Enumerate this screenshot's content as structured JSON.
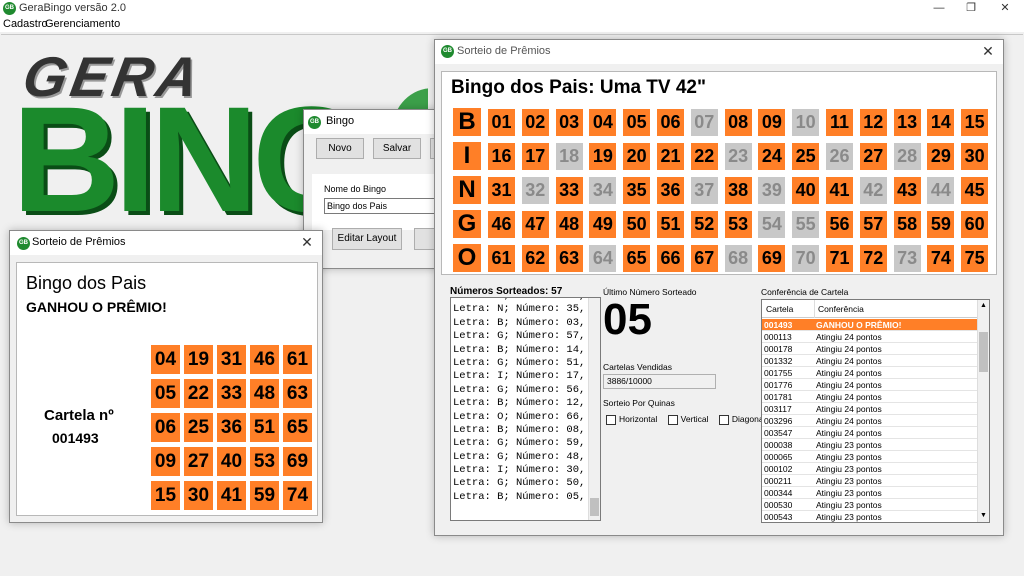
{
  "app": {
    "icon_text": "GB",
    "title": "GeraBingo  versão 2.0",
    "menu": [
      "Cadastro",
      "Gerenciamento"
    ],
    "logo_gera": "GERA",
    "logo_bingo": "BING"
  },
  "bingo_window": {
    "title": "Bingo",
    "buttons": [
      "Novo",
      "Salvar"
    ],
    "name_label": "Nome do Bingo",
    "name_value": "Bingo dos Pais",
    "edit_layout_label": "Editar Layout"
  },
  "small_prize": {
    "title": "Sorteio de Prêmios",
    "bingo_name": "Bingo dos Pais",
    "won_text": "GANHOU O PRÊMIO!",
    "card_label": "Cartela nº",
    "card_number": "001493",
    "card_grid": [
      [
        "04",
        "19",
        "31",
        "46",
        "61"
      ],
      [
        "05",
        "22",
        "33",
        "48",
        "63"
      ],
      [
        "06",
        "25",
        "36",
        "51",
        "65"
      ],
      [
        "09",
        "27",
        "40",
        "53",
        "69"
      ],
      [
        "15",
        "30",
        "41",
        "59",
        "74"
      ]
    ]
  },
  "main_prize": {
    "title": "Sorteio de Prêmios",
    "heading": "Bingo dos Pais: Uma TV 42\"",
    "letters": [
      "B",
      "I",
      "N",
      "G",
      "O"
    ],
    "board": [
      [
        [
          "01",
          1
        ],
        [
          "02",
          1
        ],
        [
          "03",
          1
        ],
        [
          "04",
          1
        ],
        [
          "05",
          1
        ],
        [
          "06",
          1
        ],
        [
          "07",
          0
        ],
        [
          "08",
          1
        ],
        [
          "09",
          1
        ],
        [
          "10",
          0
        ],
        [
          "11",
          1
        ],
        [
          "12",
          1
        ],
        [
          "13",
          1
        ],
        [
          "14",
          1
        ],
        [
          "15",
          1
        ]
      ],
      [
        [
          "16",
          1
        ],
        [
          "17",
          1
        ],
        [
          "18",
          0
        ],
        [
          "19",
          1
        ],
        [
          "20",
          1
        ],
        [
          "21",
          1
        ],
        [
          "22",
          1
        ],
        [
          "23",
          0
        ],
        [
          "24",
          1
        ],
        [
          "25",
          1
        ],
        [
          "26",
          0
        ],
        [
          "27",
          1
        ],
        [
          "28",
          0
        ],
        [
          "29",
          1
        ],
        [
          "30",
          1
        ]
      ],
      [
        [
          "31",
          1
        ],
        [
          "32",
          0
        ],
        [
          "33",
          1
        ],
        [
          "34",
          0
        ],
        [
          "35",
          1
        ],
        [
          "36",
          1
        ],
        [
          "37",
          0
        ],
        [
          "38",
          1
        ],
        [
          "39",
          0
        ],
        [
          "40",
          1
        ],
        [
          "41",
          1
        ],
        [
          "42",
          0
        ],
        [
          "43",
          1
        ],
        [
          "44",
          0
        ],
        [
          "45",
          1
        ]
      ],
      [
        [
          "46",
          1
        ],
        [
          "47",
          1
        ],
        [
          "48",
          1
        ],
        [
          "49",
          1
        ],
        [
          "50",
          1
        ],
        [
          "51",
          1
        ],
        [
          "52",
          1
        ],
        [
          "53",
          1
        ],
        [
          "54",
          0
        ],
        [
          "55",
          0
        ],
        [
          "56",
          1
        ],
        [
          "57",
          1
        ],
        [
          "58",
          1
        ],
        [
          "59",
          1
        ],
        [
          "60",
          1
        ]
      ],
      [
        [
          "61",
          1
        ],
        [
          "62",
          1
        ],
        [
          "63",
          1
        ],
        [
          "64",
          0
        ],
        [
          "65",
          1
        ],
        [
          "66",
          1
        ],
        [
          "67",
          1
        ],
        [
          "68",
          0
        ],
        [
          "69",
          1
        ],
        [
          "70",
          0
        ],
        [
          "71",
          1
        ],
        [
          "72",
          1
        ],
        [
          "73",
          0
        ],
        [
          "74",
          1
        ],
        [
          "75",
          1
        ]
      ]
    ],
    "drawn_label": "Números Sorteados: 57",
    "drawn_list": [
      "Letra: G; Número: 57,",
      "Letra: N; Número: 35,",
      "Letra: B; Número: 03,",
      "Letra: G; Número: 57,",
      "Letra: B; Número: 14,",
      "Letra: G; Número: 51,",
      "Letra: I; Número: 17,",
      "Letra: G; Número: 56,",
      "Letra: B; Número: 12,",
      "Letra: O; Número: 66,",
      "Letra: B; Número: 08,",
      "Letra: G; Número: 59,",
      "Letra: G; Número: 48,",
      "Letra: I; Número: 30,",
      "Letra: G; Número: 50,",
      "Letra: B; Número: 05,"
    ],
    "last_label": "Último Número Sorteado",
    "last_number": "05",
    "sold_label": "Cartelas Vendidas",
    "sold_value": "3886/10000",
    "quinas_label": "Sorteio Por Quinas",
    "quinas_options": [
      "Horizontal",
      "Vertical",
      "Diagonal"
    ],
    "check_label": "Conferência de Cartela",
    "check_headers": [
      "Cartela",
      "Conferência"
    ],
    "check_rows": [
      [
        "001493",
        "GANHOU O PRÊMIO!"
      ],
      [
        "000113",
        "Atingiu 24 pontos"
      ],
      [
        "000178",
        "Atingiu 24 pontos"
      ],
      [
        "001332",
        "Atingiu 24 pontos"
      ],
      [
        "001755",
        "Atingiu 24 pontos"
      ],
      [
        "001776",
        "Atingiu 24 pontos"
      ],
      [
        "001781",
        "Atingiu 24 pontos"
      ],
      [
        "003117",
        "Atingiu 24 pontos"
      ],
      [
        "003296",
        "Atingiu 24 pontos"
      ],
      [
        "003547",
        "Atingiu 24 pontos"
      ],
      [
        "000038",
        "Atingiu 23 pontos"
      ],
      [
        "000065",
        "Atingiu 23 pontos"
      ],
      [
        "000102",
        "Atingiu 23 pontos"
      ],
      [
        "000211",
        "Atingiu 23 pontos"
      ],
      [
        "000344",
        "Atingiu 23 pontos"
      ],
      [
        "000530",
        "Atingiu 23 pontos"
      ],
      [
        "000543",
        "Atingiu 23 pontos"
      ]
    ]
  },
  "colors": {
    "orange": "#ff7f27",
    "gray_cell": "#c8c8c8",
    "highlight_row": "#ff7f27",
    "green": "#1b8a2c"
  }
}
